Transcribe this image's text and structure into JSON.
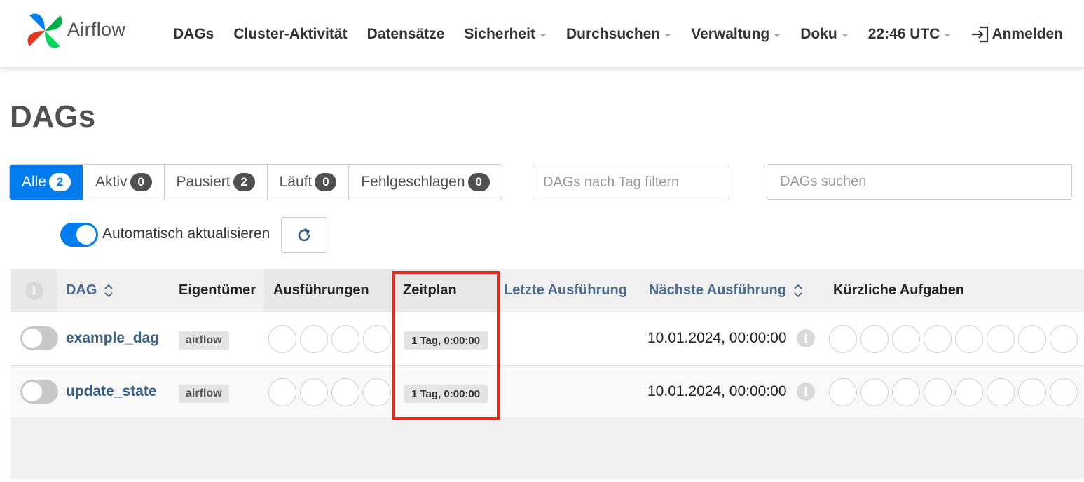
{
  "brand": {
    "name": "Airflow"
  },
  "nav": {
    "items": [
      {
        "label": "DAGs",
        "dropdown": false
      },
      {
        "label": "Cluster-Aktivität",
        "dropdown": false
      },
      {
        "label": "Datensätze",
        "dropdown": false
      },
      {
        "label": "Sicherheit",
        "dropdown": true
      },
      {
        "label": "Durchsuchen",
        "dropdown": true
      },
      {
        "label": "Verwaltung",
        "dropdown": true
      },
      {
        "label": "Doku",
        "dropdown": true
      },
      {
        "label": "22:46 UTC",
        "dropdown": true
      }
    ],
    "login_label": "Anmelden"
  },
  "page": {
    "title": "DAGs"
  },
  "filters": [
    {
      "label": "Alle",
      "count": "2",
      "active": true
    },
    {
      "label": "Aktiv",
      "count": "0",
      "active": false
    },
    {
      "label": "Pausiert",
      "count": "2",
      "active": false
    },
    {
      "label": "Läuft",
      "count": "0",
      "active": false
    },
    {
      "label": "Fehlgeschlagen",
      "count": "0",
      "active": false
    }
  ],
  "tag_filter": {
    "placeholder": "DAGs nach Tag filtern"
  },
  "search": {
    "placeholder": "DAGs suchen"
  },
  "auto_refresh": {
    "label": "Automatisch aktualisieren",
    "enabled": true
  },
  "table": {
    "headers": {
      "info": "i",
      "dag": "DAG",
      "owner": "Eigentümer",
      "runs": "Ausführungen",
      "schedule": "Zeitplan",
      "last_run": "Letzte Ausführung",
      "next_run": "Nächste Ausführung",
      "recent_tasks": "Kürzliche Aufgaben"
    },
    "rows": [
      {
        "dag": "example_dag",
        "owner": "airflow",
        "schedule": "1 Tag, 0:00:00",
        "last_run": "",
        "next_run": "10.01.2024, 00:00:00",
        "paused": true
      },
      {
        "dag": "update_state",
        "owner": "airflow",
        "schedule": "1 Tag, 0:00:00",
        "last_run": "",
        "next_run": "10.01.2024, 00:00:00",
        "paused": true
      }
    ]
  },
  "colors": {
    "primary": "#017cee",
    "link": "#3a5f83",
    "highlight": "#e8291c"
  }
}
